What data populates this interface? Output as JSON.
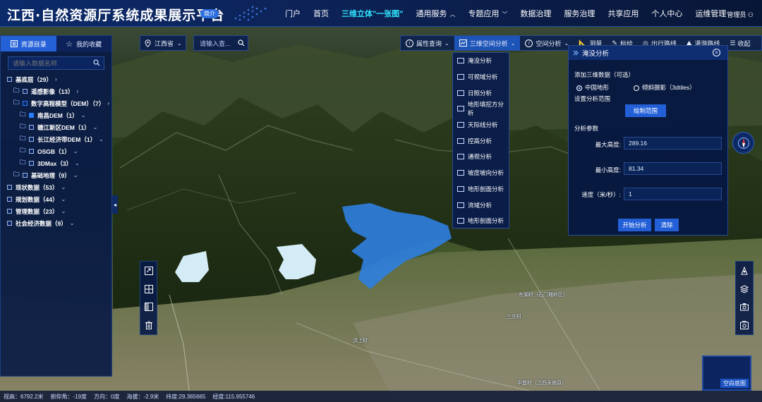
{
  "header": {
    "title": "江西·自然资源厅系统成果展示平台",
    "intro_badge": "简介",
    "nav": [
      {
        "label": "门户"
      },
      {
        "label": "首页"
      },
      {
        "label": "三维立体\"一张图\""
      },
      {
        "label": "通用服务"
      },
      {
        "label": "专题应用"
      },
      {
        "label": "数据治理"
      },
      {
        "label": "服务治理"
      },
      {
        "label": "共享应用"
      },
      {
        "label": "个人中心"
      },
      {
        "label": "运维管理"
      }
    ],
    "user": "管理员"
  },
  "left_panel": {
    "tab_catalog": "资源目录",
    "tab_favorites": "我的收藏",
    "search_placeholder": "请输入数据名称",
    "tree": [
      {
        "label": "基底层（29）"
      },
      {
        "label": "遥感影像（13）"
      },
      {
        "label": "数字高程模型（DEM）（7）"
      },
      {
        "label": "南昌DEM（1）"
      },
      {
        "label": "赣江新区DEM（1）"
      },
      {
        "label": "长江经济带DEM（1）"
      },
      {
        "label": "OSGB（1）"
      },
      {
        "label": "3DMax（3）"
      },
      {
        "label": "基础地理（9）"
      },
      {
        "label": "现状数据（53）"
      },
      {
        "label": "规划数据（44）"
      },
      {
        "label": "管理数据（23）"
      },
      {
        "label": "社会经济数据（9）"
      }
    ]
  },
  "region": {
    "value": "江西省"
  },
  "search": {
    "placeholder": "请输入查..."
  },
  "toolbar": {
    "items": [
      {
        "label": "属性查询"
      },
      {
        "label": "三维空间分析"
      },
      {
        "label": "空间分析"
      },
      {
        "label": "测量"
      },
      {
        "label": "标绘"
      },
      {
        "label": "出行路线"
      },
      {
        "label": "漫游路线"
      },
      {
        "label": "收起"
      }
    ]
  },
  "dropdown": {
    "items": [
      {
        "label": "淹没分析"
      },
      {
        "label": "可视域分析"
      },
      {
        "label": "日照分析"
      },
      {
        "label": "地形填挖方分析"
      },
      {
        "label": "天际线分析"
      },
      {
        "label": "控高分析"
      },
      {
        "label": "通视分析"
      },
      {
        "label": "坡度坡向分析"
      },
      {
        "label": "地形剖面分析"
      },
      {
        "label": "流域分析"
      },
      {
        "label": "地形剖面分析"
      }
    ]
  },
  "flood_panel": {
    "title": "淹没分析",
    "add_data_label": "添加三维数据（可选）",
    "radio_terrain": "中国地形",
    "radio_oblique": "倾斜摄影（3dtiles）",
    "range_label": "设置分析范围",
    "draw_range_button": "绘制范围",
    "params_label": "分析参数",
    "max_height_label": "最大高度:",
    "max_height_value": "289.16",
    "min_height_label": "最小高度:",
    "min_height_value": "81.34",
    "speed_label": "速度（米/秒）:",
    "speed_value": "1",
    "start_button": "开始分析",
    "clear_button": "清除"
  },
  "minimap": {
    "label": "空白底图"
  },
  "status": {
    "view_height": "视高：6792.2米",
    "pitch": "俯仰角：-19度",
    "heading": "方向：0度",
    "altitude": "海拔：-2.9米",
    "latitude": "纬度:29.365665",
    "longitude": "经度:115.955746"
  },
  "map_labels": [
    {
      "text": "东湖村（石门堰岭区）"
    },
    {
      "text": "三庄村"
    },
    {
      "text": "洪上村"
    },
    {
      "text": "中堡村（江西永修县）"
    }
  ],
  "colors": {
    "accent": "#2460d6",
    "nav_active": "#32e6ff",
    "water": "#2f7fe0"
  }
}
